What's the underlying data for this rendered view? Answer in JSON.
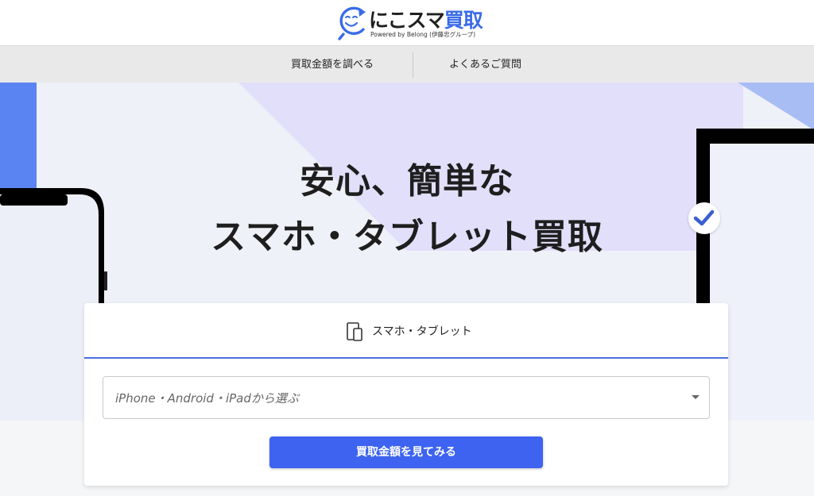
{
  "brand": {
    "logo_part1": "にこスマ",
    "logo_part2": "買取",
    "tagline": "Powered by Belong (伊藤忠グループ)",
    "accent_color": "#3a6be8",
    "logo_icon": "smile-refresh-icon"
  },
  "nav": {
    "items": [
      {
        "label": "買取金額を調べる"
      },
      {
        "label": "よくあるご質問"
      }
    ]
  },
  "hero": {
    "title_line1": "安心、簡単な",
    "title_line2": "スマホ・タブレット買取",
    "badge_icon": "check-icon"
  },
  "search": {
    "tab_label": "スマホ・タブレット",
    "tab_icon": "phone-tablet-icon",
    "select_placeholder": "iPhone・Android・iPadから選ぶ",
    "submit_label": "買取金額を見てみる",
    "button_color": "#3d63f0"
  }
}
